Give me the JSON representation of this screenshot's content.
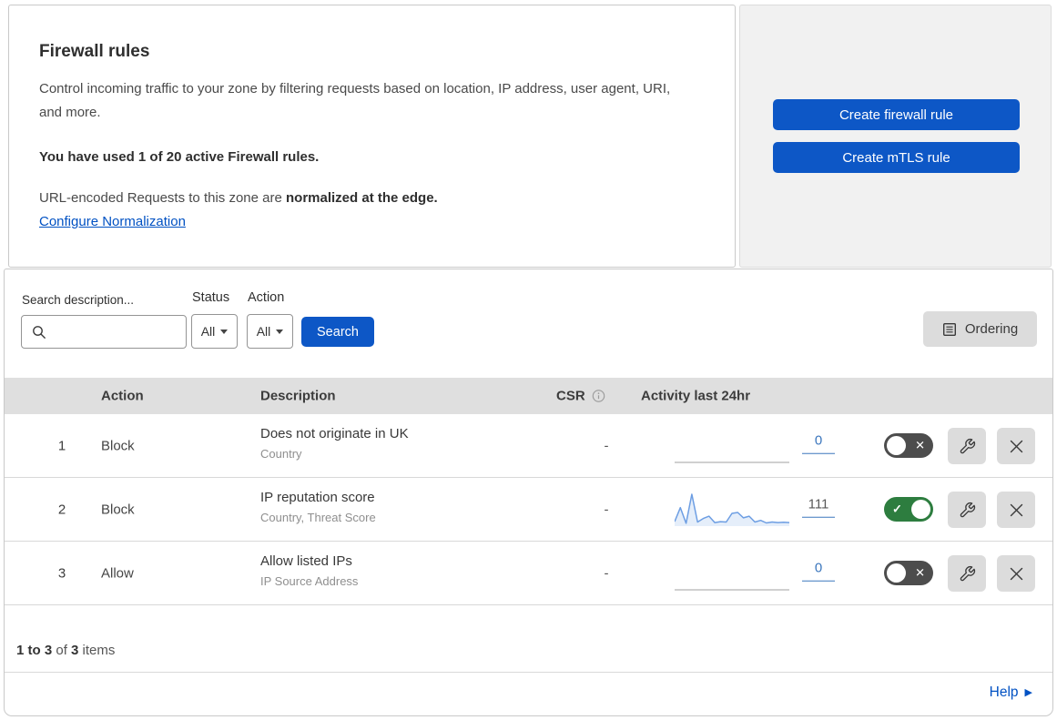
{
  "header": {
    "title": "Firewall rules",
    "description": "Control incoming traffic to your zone by filtering requests based on location, IP address, user agent, URI, and more.",
    "usage": "You have used 1 of 20 active Firewall rules.",
    "normalization_text": "URL-encoded Requests to this zone are ",
    "normalization_bold": "normalized at the edge.",
    "normalization_link": "Configure Normalization",
    "create_firewall_button": "Create firewall rule",
    "create_mtls_button": "Create mTLS rule"
  },
  "filters": {
    "search_label": "Search description...",
    "search_value": "",
    "status_label": "Status",
    "status_value": "All",
    "action_label": "Action",
    "action_value": "All",
    "search_button": "Search",
    "ordering_button": "Ordering"
  },
  "table": {
    "columns": {
      "action": "Action",
      "description": "Description",
      "csr": "CSR",
      "activity": "Activity last 24hr"
    },
    "rows": [
      {
        "index": "1",
        "action": "Block",
        "description": "Does not originate in UK",
        "fields": "Country",
        "csr": "-",
        "activity_count": "0",
        "count_color": "#3b76bd",
        "enabled": false,
        "activity_series": []
      },
      {
        "index": "2",
        "action": "Block",
        "description": "IP reputation score",
        "fields": "Country, Threat Score",
        "csr": "-",
        "activity_count": "111",
        "count_color": "#595959",
        "enabled": true,
        "activity_series": [
          14,
          58,
          9,
          100,
          13,
          24,
          31,
          11,
          14,
          13,
          40,
          43,
          26,
          31,
          13,
          18,
          10,
          13,
          11,
          12,
          11
        ]
      },
      {
        "index": "3",
        "action": "Allow",
        "description": "Allow listed IPs",
        "fields": "IP Source Address",
        "csr": "-",
        "activity_count": "0",
        "count_color": "#3b76bd",
        "enabled": false,
        "activity_series": []
      }
    ]
  },
  "footer": {
    "range_bold": "1 to 3",
    "of": " of ",
    "total_bold": "3",
    "items": " items",
    "help": "Help"
  },
  "icons": {
    "toggle_on_check": "✓",
    "toggle_off_x": "✕",
    "help_arrow": "▶"
  },
  "colors": {
    "primary_blue": "#0d57c6",
    "link_blue": "#0051c3",
    "toggle_on_green": "#2d7d3f",
    "toggle_off_gray": "#4d4d4d",
    "sparkline_line": "#6d9ee3",
    "sparkline_fill": "rgba(109,158,227,0.18)",
    "flat_line": "#b3b3b3",
    "count_underline": "#3b76bd",
    "side_panel_bg": "#f1f1f1",
    "table_header_bg": "#dfdfdf",
    "icon_button_bg": "#dcdcdc"
  }
}
